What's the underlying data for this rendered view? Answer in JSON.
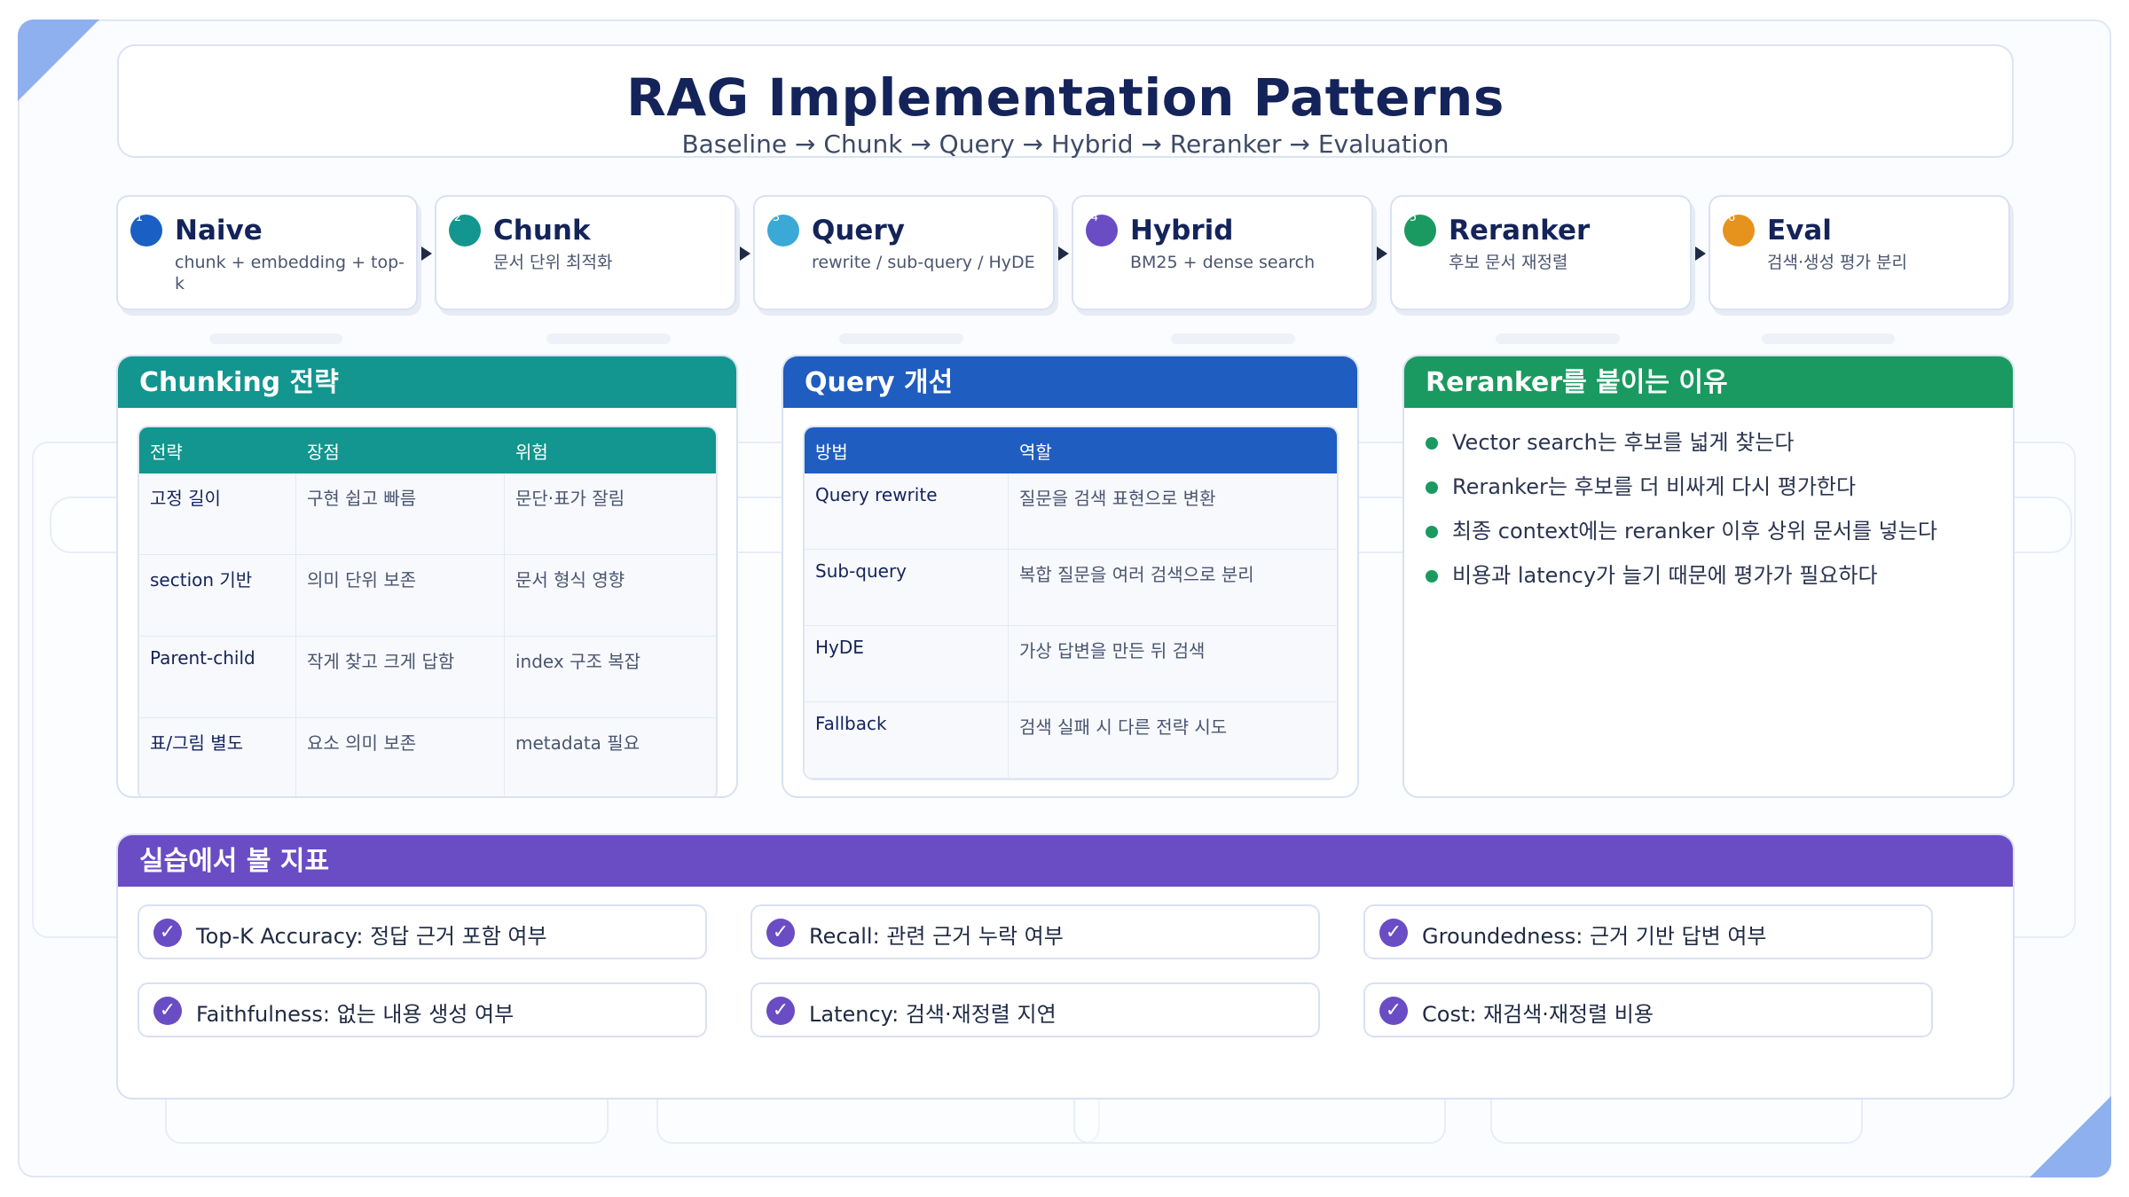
{
  "header": {
    "title": "RAG Implementation Patterns",
    "subtitle": "Baseline → Chunk → Query → Hybrid → Reranker → Evaluation"
  },
  "steps": [
    {
      "num": "1",
      "title": "Naive",
      "desc": "chunk + embedding + top-k",
      "color": "#1a5fc4"
    },
    {
      "num": "2",
      "title": "Chunk",
      "desc": "문서 단위 최적화",
      "color": "#12968f"
    },
    {
      "num": "3",
      "title": "Query",
      "desc": "rewrite / sub-query / HyDE",
      "color": "#3aa9d6"
    },
    {
      "num": "4",
      "title": "Hybrid",
      "desc": "BM25 + dense search",
      "color": "#6a4cc4"
    },
    {
      "num": "5",
      "title": "Reranker",
      "desc": "후보 문서 재정렬",
      "color": "#1a9a60"
    },
    {
      "num": "6",
      "title": "Eval",
      "desc": "검색·생성 평가 분리",
      "color": "#e6931e"
    }
  ],
  "chunking": {
    "title": "Chunking 전략",
    "color": "#12968f",
    "headers": [
      "전략",
      "장점",
      "위험"
    ],
    "rows": [
      [
        "고정 길이",
        "구현 쉽고 빠름",
        "문단·표가 잘림"
      ],
      [
        "section 기반",
        "의미 단위 보존",
        "문서 형식 영향"
      ],
      [
        "Parent-child",
        "작게 찾고 크게 답함",
        "index 구조 복잡"
      ],
      [
        "표/그림 별도",
        "요소 의미 보존",
        "metadata 필요"
      ]
    ]
  },
  "query": {
    "title": "Query 개선",
    "color": "#1f5dc0",
    "headers": [
      "방법",
      "역할"
    ],
    "rows": [
      [
        "Query rewrite",
        "질문을 검색 표현으로 변환"
      ],
      [
        "Sub-query",
        "복합 질문을 여러 검색으로 분리"
      ],
      [
        "HyDE",
        "가상 답변을 만든 뒤 검색"
      ],
      [
        "Fallback",
        "검색 실패 시 다른 전략 시도"
      ]
    ]
  },
  "reranker": {
    "title": "Reranker를 붙이는 이유",
    "color": "#1a9a60",
    "items": [
      "Vector search는 후보를 넓게 찾는다",
      "Reranker는 후보를 더 비싸게 다시 평가한다",
      "최종 context에는 reranker 이후 상위 문서를 넣는다",
      "비용과 latency가 늘기 때문에 평가가 필요하다"
    ]
  },
  "metrics": {
    "title": "실습에서 볼 지표",
    "color": "#6a4cc4",
    "items": [
      "Top-K Accuracy: 정답 근거 포함 여부",
      "Recall: 관련 근거 누락 여부",
      "Groundedness: 근거 기반 답변 여부",
      "Faithfulness: 없는 내용 생성 여부",
      "Latency: 검색·재정렬 지연",
      "Cost: 재검색·재정렬 비용"
    ]
  }
}
